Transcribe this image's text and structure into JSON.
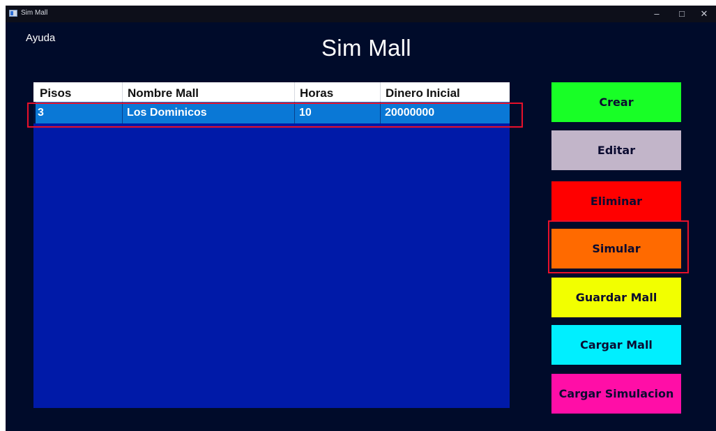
{
  "window": {
    "title": "Sim Mall",
    "controls": {
      "minimize": "–",
      "maximize": "□",
      "close": "✕"
    }
  },
  "menu": {
    "help": "Ayuda"
  },
  "header": {
    "title": "Sim Mall"
  },
  "table": {
    "columns": [
      "Pisos",
      "Nombre Mall",
      "Horas",
      "Dinero Inicial"
    ],
    "rows": [
      [
        "3",
        "Los Dominicos",
        "10",
        "20000000"
      ]
    ]
  },
  "buttons": [
    {
      "label": "Crear",
      "color": "#18ff26"
    },
    {
      "label": "Editar",
      "color": "#c2b5c9"
    },
    {
      "label": "Eliminar",
      "color": "#ff0000"
    },
    {
      "label": "Simular",
      "color": "#ff6a00"
    },
    {
      "label": "Guardar Mall",
      "color": "#f2ff00"
    },
    {
      "label": "Cargar Mall",
      "color": "#00efff"
    },
    {
      "label": "Cargar Simulacion",
      "color": "#ff0ea7"
    }
  ],
  "colors": {
    "background": "#000b2a",
    "grid_background": "#001aa8",
    "selected_row": "#0a78d6",
    "highlight_outline": "#e8102a"
  }
}
